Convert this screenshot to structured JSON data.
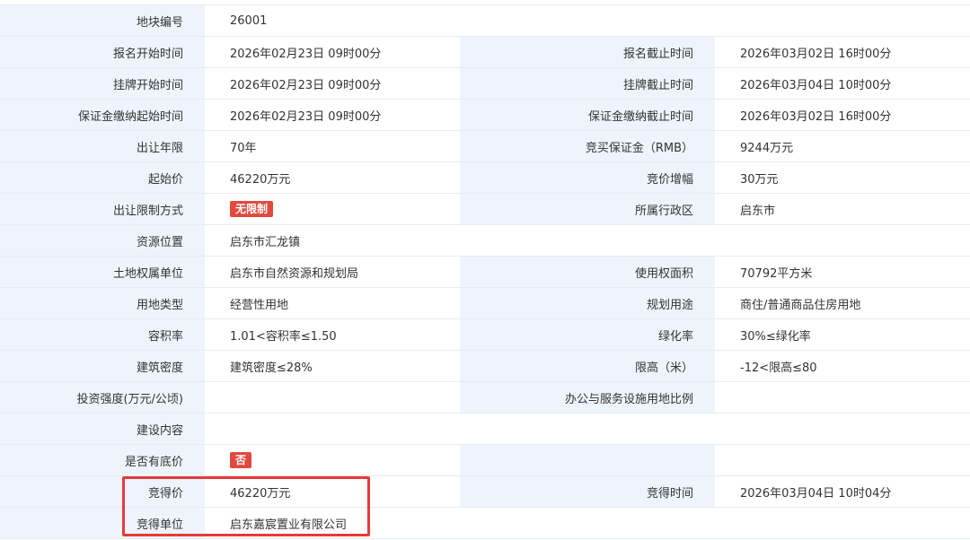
{
  "rows": [
    {
      "l1": "地块编号",
      "v1": "26001",
      "full": true
    },
    {
      "l1": "报名开始时间",
      "v1": "2026年02月23日 09时00分",
      "l2": "报名截止时间",
      "v2": "2026年03月02日 16时00分"
    },
    {
      "l1": "挂牌开始时间",
      "v1": "2026年02月23日 09时00分",
      "l2": "挂牌截止时间",
      "v2": "2026年03月04日 10时00分"
    },
    {
      "l1": "保证金缴纳起始时间",
      "v1": "2026年02月23日 09时00分",
      "l2": "保证金缴纳截止时间",
      "v2": "2026年03月02日 16时00分"
    },
    {
      "l1": "出让年限",
      "v1": "70年",
      "l2": "竞买保证金（RMB）",
      "v2": "9244万元"
    },
    {
      "l1": "起始价",
      "v1": "46220万元",
      "l2": "竞价增幅",
      "v2": "30万元"
    },
    {
      "l1": "出让限制方式",
      "v1_badge": "无限制",
      "l2": "所属行政区",
      "v2": "启东市"
    },
    {
      "l1": "资源位置",
      "v1": "启东市汇龙镇",
      "full": true
    },
    {
      "l1": "土地权属单位",
      "v1": "启东市自然资源和规划局",
      "l2": "使用权面积",
      "v2": "70792平方米"
    },
    {
      "l1": "用地类型",
      "v1": "经营性用地",
      "l2": "规划用途",
      "v2": "商住/普通商品住房用地"
    },
    {
      "l1": "容积率",
      "v1": "1.01<容积率≤1.50",
      "l2": "绿化率",
      "v2": "30%≤绿化率"
    },
    {
      "l1": "建筑密度",
      "v1": "建筑密度≤28%",
      "l2": "限高（米）",
      "v2": "-12<限高≤80"
    },
    {
      "l1": "投资强度(万元/公顷)",
      "v1": "",
      "l2": "办公与服务设施用地比例",
      "v2": ""
    },
    {
      "l1": "建设内容",
      "v1": "",
      "full": true
    },
    {
      "l1": "是否有底价",
      "v1_badge": "否",
      "l2": "",
      "v2": ""
    },
    {
      "l1": "竞得价",
      "v1": "46220万元",
      "l2": "竞得时间",
      "v2": "2026年03月04日 10时04分"
    },
    {
      "l1": "竞得单位",
      "v1": "启东嘉宸置业有限公司",
      "l2": "",
      "v2": ""
    }
  ],
  "colors": {
    "label_bg": "#eef4fb",
    "badge_red": "#e04a3f",
    "highlight_border": "#e83a3a"
  }
}
